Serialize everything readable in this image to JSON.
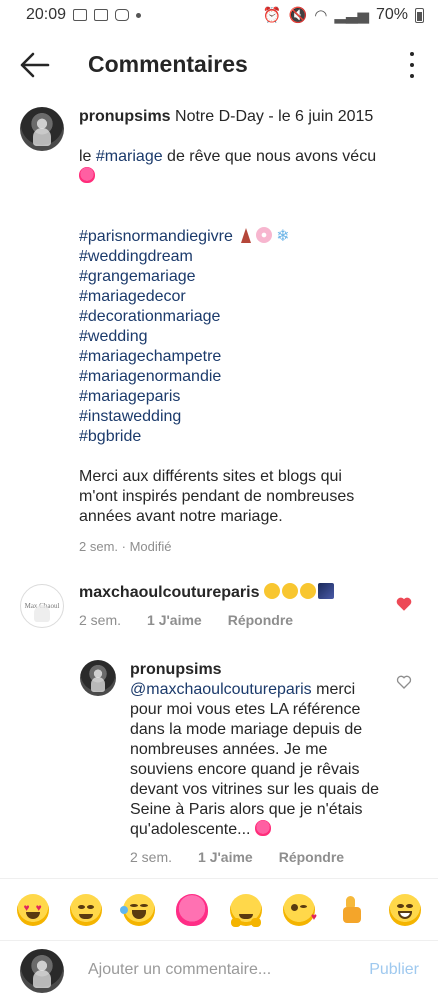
{
  "status_bar": {
    "time": "20:09",
    "battery": "70%"
  },
  "header": {
    "title": "Commentaires"
  },
  "post": {
    "username": "pronupsims",
    "title_text": " Notre D-Day - le 6 juin 2015",
    "line1_before": "le ",
    "line1_tag": "#mariage",
    "line1_after": " de rêve que nous avons vécu",
    "hashtags": [
      "#parisnormandiegivre",
      "#weddingdream",
      "#grangemariage",
      "#mariagedecor",
      "#decorationmariage",
      "#wedding",
      "#mariagechampetre",
      "#mariagenormandie",
      "#mariageparis",
      "#instawedding",
      "#bgbride"
    ],
    "closing": "Merci aux différents sites et blogs qui m'ont inspirés pendant de nombreuses années avant notre mariage.",
    "time": "2 sem.",
    "modified": " · Modifié"
  },
  "comment1": {
    "avatar_text": "Max Chaoul",
    "username": "maxchaoulcoutureparis",
    "time": "2 sem.",
    "likes": "1 J'aime",
    "reply": "Répondre"
  },
  "comment2": {
    "username": "pronupsims",
    "mention": "@maxchaoulcoutureparis",
    "text": " merci pour moi vous etes LA référence dans la mode mariage depuis de nombreuses années. Je me souviens encore quand je rêvais devant vos vitrines sur les quais de Seine à Paris alors que je n'étais qu'adolescente...",
    "time": "2 sem.",
    "likes": "1 J'aime",
    "reply": "Répondre"
  },
  "input": {
    "placeholder": "Ajouter un commentaire...",
    "publish_label": "Publier"
  },
  "colors": {
    "link": "#1b3a6b",
    "heart": "#ed4956",
    "publish": "#9fc9ef"
  }
}
